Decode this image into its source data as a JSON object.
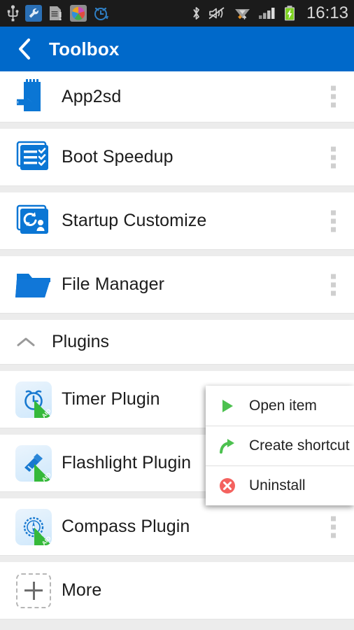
{
  "status_bar": {
    "time": "16:13",
    "left_icons": [
      "usb-icon",
      "wrench-icon",
      "sdcard-warning-icon",
      "app-circle-icon",
      "alarm-icon"
    ],
    "right_icons": [
      "bluetooth-icon",
      "sound-muted-icon",
      "wifi-data-icon",
      "signal-bars-icon",
      "battery-charging-icon"
    ],
    "background": "#1b1b1b"
  },
  "appbar": {
    "title": "Toolbox",
    "back_icon": "back-chevron-icon",
    "background": "#0069ca",
    "text_color": "#ffffff"
  },
  "list": {
    "tools": [
      {
        "label": "App2sd",
        "icon": "sdcard-arrow-icon",
        "overflow": "overflow-dots-icon"
      },
      {
        "label": "Boot Speedup",
        "icon": "boot-list-check-icon",
        "overflow": "overflow-dots-icon"
      },
      {
        "label": "Startup Customize",
        "icon": "startup-refresh-user-icon",
        "overflow": "overflow-dots-icon"
      },
      {
        "label": "File Manager",
        "icon": "folder-icon",
        "overflow": "overflow-dots-icon"
      }
    ],
    "section": {
      "label": "Plugins",
      "collapse_icon": "chevron-up-icon"
    },
    "plugins": [
      {
        "label": "Timer Plugin",
        "icon": "alarm-clock-icon",
        "badge": "AIO",
        "overflow": "overflow-dots-icon"
      },
      {
        "label": "Flashlight Plugin",
        "icon": "flashlight-icon",
        "badge": "AIO",
        "overflow": "overflow-dots-icon"
      },
      {
        "label": "Compass Plugin",
        "icon": "compass-icon",
        "badge": "AIO",
        "overflow": "overflow-dots-icon"
      }
    ],
    "more": {
      "label": "More",
      "icon": "plus-icon"
    }
  },
  "popup_menu": {
    "items": [
      {
        "label": "Open item",
        "icon": "play-triangle-icon",
        "color": "#4cc14f"
      },
      {
        "label": "Create shortcut",
        "icon": "shortcut-arrow-icon",
        "color": "#4cc14f"
      },
      {
        "label": "Uninstall",
        "icon": "uninstall-circle-x-icon",
        "color": "#f4625f"
      }
    ]
  },
  "colors": {
    "accent_blue": "#0069ca",
    "icon_blue": "#0b76d4",
    "page_background": "#ececec",
    "card_background": "#ffffff"
  }
}
